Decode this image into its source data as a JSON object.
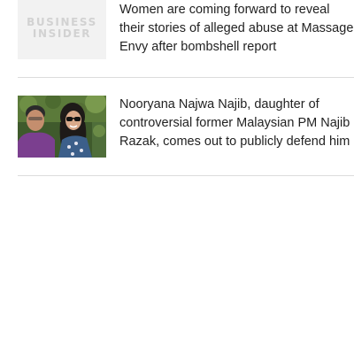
{
  "articles": [
    {
      "headline": "Women are coming forward to reveal their stories of alleged abuse at Massage Envy after bombshell report",
      "thumbnail": {
        "kind": "publisher-logo",
        "logo_lines": [
          "BUSINESS",
          "INSIDER"
        ]
      }
    },
    {
      "headline": "Nooryana Najwa Najib, daughter of controversial former Malaysian PM Najib Razak, comes out to publicly defend him",
      "thumbnail": {
        "kind": "photo"
      }
    }
  ],
  "colors": {
    "headline_text": "#222222",
    "divider": "#dcdcdc",
    "logo_text": "#d2d2d2",
    "logo_background": "#f2f2f2"
  }
}
